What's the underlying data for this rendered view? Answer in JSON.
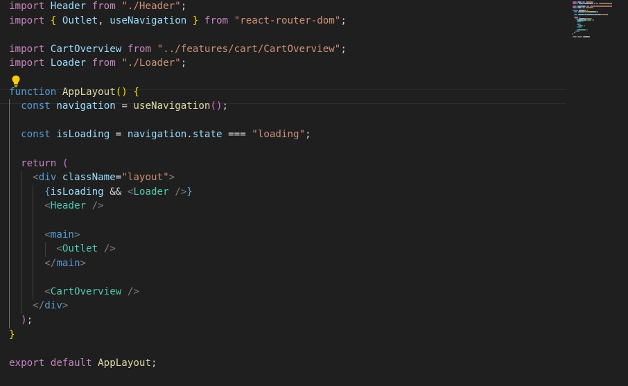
{
  "editor": {
    "language": "javascript-jsx",
    "lines": [
      [
        [
          "kw",
          "import"
        ],
        [
          "pun",
          " "
        ],
        [
          "var",
          "Header"
        ],
        [
          "pun",
          " "
        ],
        [
          "kw",
          "from"
        ],
        [
          "pun",
          " "
        ],
        [
          "str",
          "\"./Header\""
        ],
        [
          "pun",
          ";"
        ]
      ],
      [
        [
          "kw",
          "import"
        ],
        [
          "pun",
          " "
        ],
        [
          "b1",
          "{"
        ],
        [
          "pun",
          " "
        ],
        [
          "var",
          "Outlet"
        ],
        [
          "pun",
          ", "
        ],
        [
          "var",
          "useNavigation"
        ],
        [
          "pun",
          " "
        ],
        [
          "b1",
          "}"
        ],
        [
          "pun",
          " "
        ],
        [
          "kw",
          "from"
        ],
        [
          "pun",
          " "
        ],
        [
          "str",
          "\"react-router-dom\""
        ],
        [
          "pun",
          ";"
        ]
      ],
      [],
      [
        [
          "kw",
          "import"
        ],
        [
          "pun",
          " "
        ],
        [
          "var",
          "CartOverview"
        ],
        [
          "pun",
          " "
        ],
        [
          "kw",
          "from"
        ],
        [
          "pun",
          " "
        ],
        [
          "str",
          "\"../features/cart/CartOverview\""
        ],
        [
          "pun",
          ";"
        ]
      ],
      [
        [
          "kw",
          "import"
        ],
        [
          "pun",
          " "
        ],
        [
          "var",
          "Loader"
        ],
        [
          "pun",
          " "
        ],
        [
          "kw",
          "from"
        ],
        [
          "pun",
          " "
        ],
        [
          "str",
          "\"./Loader\""
        ],
        [
          "pun",
          ";"
        ]
      ],
      [],
      [
        [
          "st",
          "function"
        ],
        [
          "pun",
          " "
        ],
        [
          "fn",
          "AppLayout"
        ],
        [
          "b1",
          "()"
        ],
        [
          "pun",
          " "
        ],
        [
          "b1",
          "{"
        ]
      ],
      [
        [
          "pun",
          "  "
        ],
        [
          "st",
          "const"
        ],
        [
          "pun",
          " "
        ],
        [
          "var",
          "navigation"
        ],
        [
          "pun",
          " = "
        ],
        [
          "fn",
          "useNavigation"
        ],
        [
          "b2",
          "()"
        ],
        [
          "pun",
          ";"
        ]
      ],
      [],
      [
        [
          "pun",
          "  "
        ],
        [
          "st",
          "const"
        ],
        [
          "pun",
          " "
        ],
        [
          "var",
          "isLoading"
        ],
        [
          "pun",
          " = "
        ],
        [
          "var",
          "navigation"
        ],
        [
          "pun",
          "."
        ],
        [
          "var",
          "state"
        ],
        [
          "pun",
          " === "
        ],
        [
          "str",
          "\"loading\""
        ],
        [
          "pun",
          ";"
        ]
      ],
      [],
      [
        [
          "pun",
          "  "
        ],
        [
          "kw",
          "return"
        ],
        [
          "pun",
          " "
        ],
        [
          "b2",
          "("
        ]
      ],
      [
        [
          "pun",
          "    "
        ],
        [
          "ang",
          "<"
        ],
        [
          "tag",
          "div"
        ],
        [
          "pun",
          " "
        ],
        [
          "attr",
          "className"
        ],
        [
          "pun",
          "="
        ],
        [
          "str",
          "\"layout\""
        ],
        [
          "ang",
          ">"
        ]
      ],
      [
        [
          "pun",
          "      "
        ],
        [
          "st",
          "{"
        ],
        [
          "var",
          "isLoading"
        ],
        [
          "pun",
          " && "
        ],
        [
          "ang",
          "<"
        ],
        [
          "comp",
          "Loader"
        ],
        [
          "pun",
          " "
        ],
        [
          "ang",
          "/>"
        ],
        [
          "st",
          "}"
        ]
      ],
      [
        [
          "pun",
          "      "
        ],
        [
          "ang",
          "<"
        ],
        [
          "comp",
          "Header"
        ],
        [
          "pun",
          " "
        ],
        [
          "ang",
          "/>"
        ]
      ],
      [],
      [
        [
          "pun",
          "      "
        ],
        [
          "ang",
          "<"
        ],
        [
          "tag",
          "main"
        ],
        [
          "ang",
          ">"
        ]
      ],
      [
        [
          "pun",
          "        "
        ],
        [
          "ang",
          "<"
        ],
        [
          "comp",
          "Outlet"
        ],
        [
          "pun",
          " "
        ],
        [
          "ang",
          "/>"
        ]
      ],
      [
        [
          "pun",
          "      "
        ],
        [
          "ang",
          "</"
        ],
        [
          "tag",
          "main"
        ],
        [
          "ang",
          ">"
        ]
      ],
      [],
      [
        [
          "pun",
          "      "
        ],
        [
          "ang",
          "<"
        ],
        [
          "comp",
          "CartOverview"
        ],
        [
          "pun",
          " "
        ],
        [
          "ang",
          "/>"
        ]
      ],
      [
        [
          "pun",
          "    "
        ],
        [
          "ang",
          "</"
        ],
        [
          "tag",
          "div"
        ],
        [
          "ang",
          ">"
        ]
      ],
      [
        [
          "pun",
          "  "
        ],
        [
          "b2",
          ")"
        ],
        [
          "pun",
          ";"
        ]
      ],
      [
        [
          "b1",
          "}"
        ]
      ],
      [],
      [
        [
          "kw",
          "export"
        ],
        [
          "pun",
          " "
        ],
        [
          "kw",
          "default"
        ],
        [
          "pun",
          " "
        ],
        [
          "fn",
          "AppLayout"
        ],
        [
          "pun",
          ";"
        ]
      ]
    ]
  },
  "lightbulb": {
    "icon": "lightbulb-icon",
    "color": "#ffcc00"
  },
  "colors": {
    "background": "#1f1f1f",
    "keyword": "#c586c0",
    "storage": "#569cd6",
    "variable": "#9cdcfe",
    "function": "#dcdcaa",
    "string": "#ce9178",
    "component": "#4ec9b0"
  }
}
